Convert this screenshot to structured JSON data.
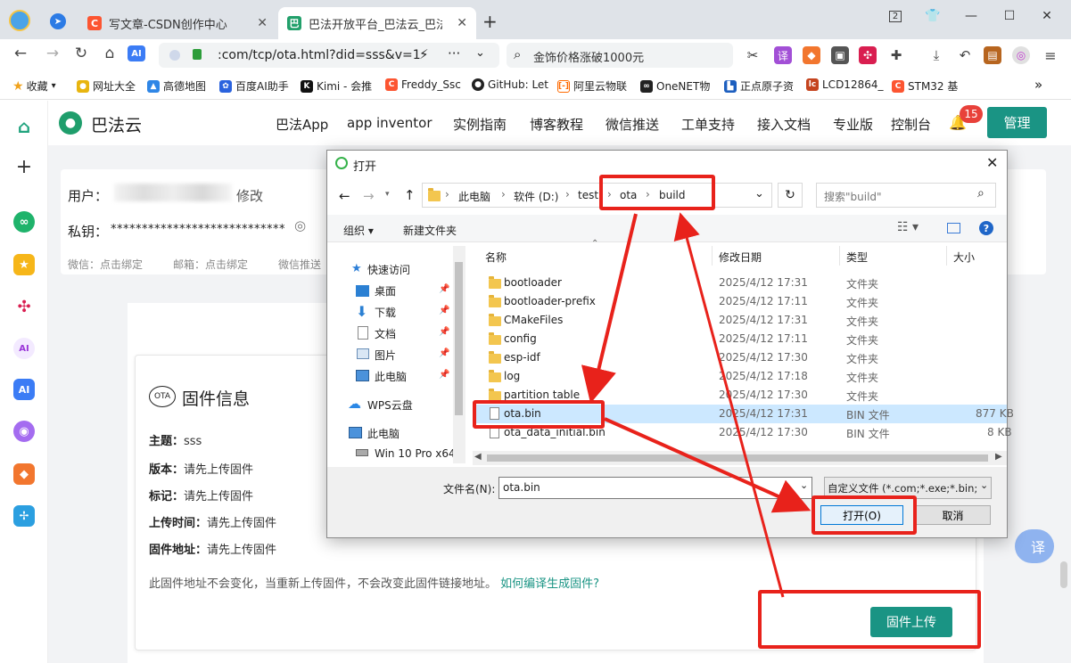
{
  "browser": {
    "tabs": [
      {
        "title": "写文章-CSDN创作中心",
        "favicon": "C",
        "color": "#fc5531"
      },
      {
        "title": "巴法开放平台_巴法云_巴法物联",
        "favicon": "巴",
        "color": "#22a06b"
      }
    ],
    "window_counter": "2",
    "url": ":com/tcp/ota.html?did=sss&v=1",
    "search_text": "金饰价格涨破1000元",
    "bookmarks": [
      "收藏",
      "网址大全",
      "高德地图",
      "百度AI助手",
      "Kimi - 会推",
      "Freddy_Ssc",
      "GitHub: Let",
      "阿里云物联",
      "OneNET物",
      "正点原子资",
      "LCD12864_",
      "STM32 基"
    ],
    "more": "»"
  },
  "site": {
    "brand": "巴法云",
    "nav": [
      "巴法App",
      "app inventor",
      "实例指南",
      "博客教程",
      "微信推送",
      "工单支持",
      "接入文档",
      "专业版",
      "控制台"
    ],
    "notification_count": "15",
    "manage_label": "管理"
  },
  "account": {
    "user_label": "用户：",
    "edit_label": "修改",
    "key_label": "私钥：",
    "key_mask": "****************************",
    "wechat": "微信：点击绑定",
    "email": "邮箱：点击绑定",
    "push": "微信推送"
  },
  "firmware": {
    "ota_badge": "OTA",
    "title": "固件信息",
    "topic_label": "主题：",
    "topic_value": "sss",
    "version_label": "版本：",
    "version_value": "请先上传固件",
    "tag_label": "标记：",
    "tag_value": "请先上传固件",
    "time_label": "上传时间：",
    "time_value": "请先上传固件",
    "addr_label": "固件地址：",
    "addr_value": "请先上传固件",
    "note": "此固件地址不会变化，当重新上传固件，不会改变此固件链接地址。",
    "help_link": "如何编译生成固件?",
    "upload_label": "固件上传",
    "translate_label": "译"
  },
  "dialog": {
    "title": "打开",
    "breadcrumb": [
      "此电脑",
      "软件 (D:)",
      "test",
      "ota",
      "build"
    ],
    "search_placeholder": "搜索\"build\"",
    "organize_label": "组织 ▾",
    "new_folder_label": "新建文件夹",
    "columns": {
      "name": "名称",
      "date": "修改日期",
      "type": "类型",
      "size": "大小"
    },
    "tree": [
      {
        "label": "快速访问",
        "icon": "star"
      },
      {
        "label": "桌面",
        "icon": "desktop",
        "pinned": true
      },
      {
        "label": "下载",
        "icon": "download",
        "pinned": true
      },
      {
        "label": "文档",
        "icon": "document",
        "pinned": true
      },
      {
        "label": "图片",
        "icon": "picture",
        "pinned": true
      },
      {
        "label": "此电脑",
        "icon": "computer",
        "pinned": true
      },
      {
        "label": "WPS云盘",
        "icon": "cloud"
      },
      {
        "label": "此电脑",
        "icon": "computer"
      },
      {
        "label": "Win 10 Pro x64",
        "icon": "drive"
      }
    ],
    "files": [
      {
        "name": "bootloader",
        "date": "2025/4/12 17:31",
        "type": "文件夹",
        "size": "",
        "kind": "folder"
      },
      {
        "name": "bootloader-prefix",
        "date": "2025/4/12 17:11",
        "type": "文件夹",
        "size": "",
        "kind": "folder"
      },
      {
        "name": "CMakeFiles",
        "date": "2025/4/12 17:31",
        "type": "文件夹",
        "size": "",
        "kind": "folder"
      },
      {
        "name": "config",
        "date": "2025/4/12 17:11",
        "type": "文件夹",
        "size": "",
        "kind": "folder"
      },
      {
        "name": "esp-idf",
        "date": "2025/4/12 17:30",
        "type": "文件夹",
        "size": "",
        "kind": "folder"
      },
      {
        "name": "log",
        "date": "2025/4/12 17:18",
        "type": "文件夹",
        "size": "",
        "kind": "folder"
      },
      {
        "name": "partition table",
        "date": "2025/4/12 17:30",
        "type": "文件夹",
        "size": "",
        "kind": "folder"
      },
      {
        "name": "ota.bin",
        "date": "2025/4/12 17:31",
        "type": "BIN 文件",
        "size": "877 KB",
        "kind": "file",
        "selected": true
      },
      {
        "name": "ota_data_initial.bin",
        "date": "2025/4/12 17:30",
        "type": "BIN 文件",
        "size": "8 KB",
        "kind": "file"
      }
    ],
    "filename_label": "文件名(N):",
    "filename_value": "ota.bin",
    "filter_value": "自定义文件 (*.com;*.exe;*.bin;",
    "open_label": "打开(O)",
    "cancel_label": "取消"
  },
  "colors": {
    "annotation": "#e8221b",
    "teal": "#1a9484",
    "selection": "#cce8ff"
  }
}
